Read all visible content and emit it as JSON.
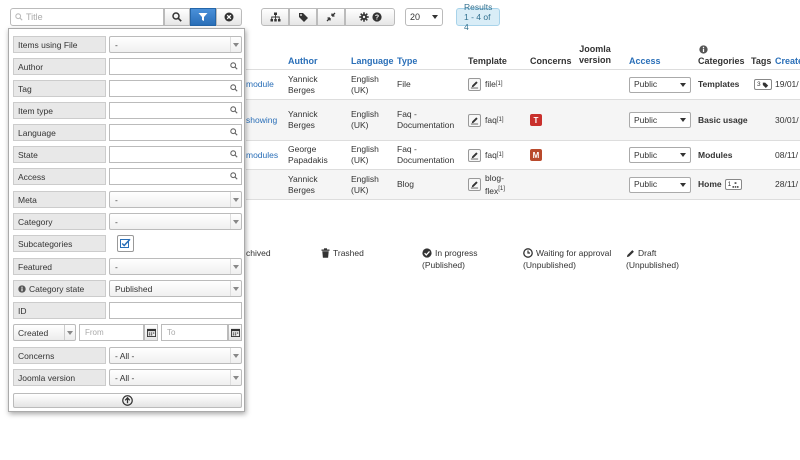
{
  "toolbar": {
    "search_placeholder": "Title",
    "per_page": "20",
    "results": "Results 1 - 4 of 4"
  },
  "table": {
    "headers": {
      "author": "Author",
      "language": "Language",
      "type": "Type",
      "template": "Template",
      "concerns": "Concerns",
      "joomla_version": "Joomla version",
      "access": "Access",
      "categories": "Categories",
      "tags": "Tags",
      "created": "Create"
    },
    "rows": [
      {
        "title_fragment": "module",
        "author": "Yannick Berges",
        "language": "English (UK)",
        "type": "File",
        "template": "file",
        "template_sup": "[1]",
        "concern": "",
        "access": "Public",
        "category": "Templates",
        "tag_count": "3",
        "created": "19/01/"
      },
      {
        "title_fragment": "showing",
        "author": "Yannick Berges",
        "language": "English (UK)",
        "type": "Faq - Documentation",
        "template": "faq",
        "template_sup": "[1]",
        "concern": "T",
        "access": "Public",
        "category": "Basic usage",
        "tag_count": "",
        "created": "30/01/"
      },
      {
        "title_fragment": "modules",
        "author": "George Papadakis",
        "language": "English (UK)",
        "type": "Faq - Documentation",
        "template": "faq",
        "template_sup": "[1]",
        "concern": "M",
        "access": "Public",
        "category": "Modules",
        "tag_count": "",
        "created": "08/11/"
      },
      {
        "title_fragment": "",
        "author": "Yannick Berges",
        "language": "English (UK)",
        "type": "Blog",
        "template": "blog-flex",
        "template_sup": "[1]",
        "concern": "",
        "access": "Public",
        "category": "Home",
        "tag_count": "1",
        "created": "28/11/"
      }
    ]
  },
  "legend": {
    "archived": "chived",
    "trashed": "Trashed",
    "in_progress": "In progress",
    "in_progress_sub": "(Published)",
    "waiting": "Waiting for approval",
    "waiting_sub": "(Unpublished)",
    "draft": "Draft",
    "draft_sub": "(Unpublished)"
  },
  "filters": {
    "items_using_file": {
      "label": "Items using File",
      "value": "-"
    },
    "author": {
      "label": "Author"
    },
    "tag": {
      "label": "Tag"
    },
    "item_type": {
      "label": "Item type"
    },
    "language": {
      "label": "Language"
    },
    "state": {
      "label": "State"
    },
    "access": {
      "label": "Access"
    },
    "meta": {
      "label": "Meta",
      "value": "-"
    },
    "category": {
      "label": "Category",
      "value": "-"
    },
    "subcategories": {
      "label": "Subcategories"
    },
    "featured": {
      "label": "Featured",
      "value": "-"
    },
    "category_state": {
      "label": "Category state",
      "value": "Published"
    },
    "id": {
      "label": "ID"
    },
    "date_field": "Created",
    "date_from": "From",
    "date_to": "To",
    "concerns": {
      "label": "Concerns",
      "value": "- All -"
    },
    "joomla_version": {
      "label": "Joomla version",
      "value": "- All -"
    }
  }
}
